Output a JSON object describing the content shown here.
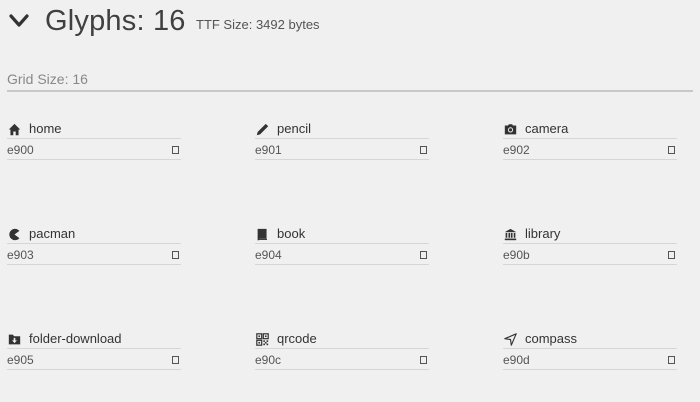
{
  "header": {
    "title": "Glyphs: 16",
    "ttf_size": "TTF Size: 3492 bytes"
  },
  "grid_size": {
    "value": "Grid Size: 16"
  },
  "glyphs": [
    {
      "name": "home",
      "code": "e900",
      "icon": "home-icon"
    },
    {
      "name": "pencil",
      "code": "e901",
      "icon": "pencil-icon"
    },
    {
      "name": "camera",
      "code": "e902",
      "icon": "camera-icon"
    },
    {
      "name": "pacman",
      "code": "e903",
      "icon": "pacman-icon"
    },
    {
      "name": "book",
      "code": "e904",
      "icon": "book-icon"
    },
    {
      "name": "library",
      "code": "e90b",
      "icon": "library-icon"
    },
    {
      "name": "folder-download",
      "code": "e905",
      "icon": "folder-download-icon"
    },
    {
      "name": "qrcode",
      "code": "e90c",
      "icon": "qrcode-icon"
    },
    {
      "name": "compass",
      "code": "e90d",
      "icon": "compass-icon"
    }
  ]
}
